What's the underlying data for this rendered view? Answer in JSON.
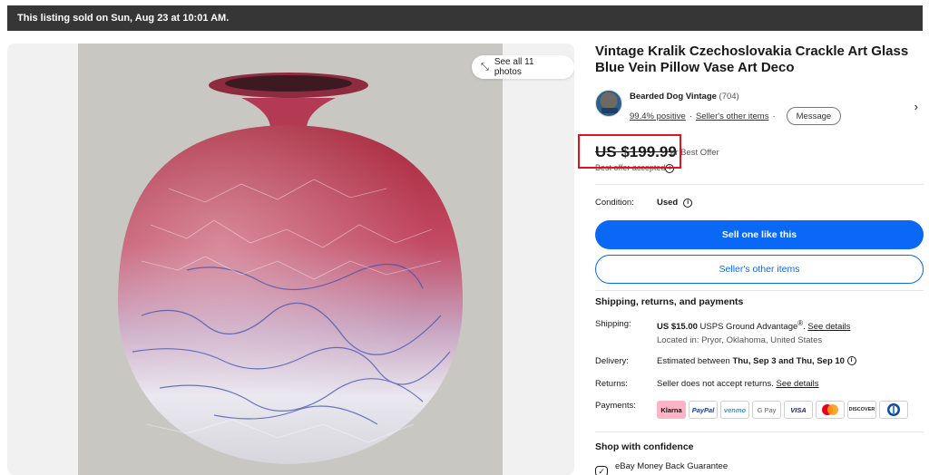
{
  "banner": {
    "text": "This listing sold on Sun, Aug 23 at 10:01 AM."
  },
  "gallery": {
    "see_all": "See all 11 photos",
    "expand_icon": "expand-arrows-icon"
  },
  "listing": {
    "title": "Vintage Kralik Czechoslovakia Crackle Art Glass Blue Vein Pillow Vase Art Deco"
  },
  "seller": {
    "name": "Bearded Dog Vintage",
    "count": "(704)",
    "positive": "99.4% positive",
    "other_items": "Seller's other items",
    "message": "Message"
  },
  "price": {
    "amount": "US $199.99",
    "offer": "or Best Offer",
    "accepted": "Best offer accepted"
  },
  "condition": {
    "label": "Condition:",
    "value": "Used"
  },
  "buttons": {
    "sell": "Sell one like this",
    "other": "Seller's other items"
  },
  "shipping": {
    "heading": "Shipping, returns, and payments",
    "shipping_label": "Shipping:",
    "shipping_price": "US $15.00",
    "shipping_service": "USPS Ground Advantage",
    "reg_mark": "®",
    "see_details": "See details",
    "location": "Located in: Pryor, Oklahoma, United States",
    "delivery_label": "Delivery:",
    "delivery_prefix": "Estimated between",
    "delivery_dates": "Thu, Sep 3 and Thu, Sep 10",
    "returns_label": "Returns:",
    "returns_text": "Seller does not accept returns.",
    "returns_link": "See details",
    "payments_label": "Payments:",
    "payments": [
      "Klarna",
      "PayPal",
      "venmo",
      "G Pay",
      "VISA",
      "",
      "DISCOVER",
      ""
    ]
  },
  "confidence": {
    "heading": "Shop with confidence",
    "guarantee": "eBay Money Back Guarantee"
  },
  "colors": {
    "accent": "#0968f6",
    "banner": "#363636",
    "highlight": "#e0141e"
  }
}
